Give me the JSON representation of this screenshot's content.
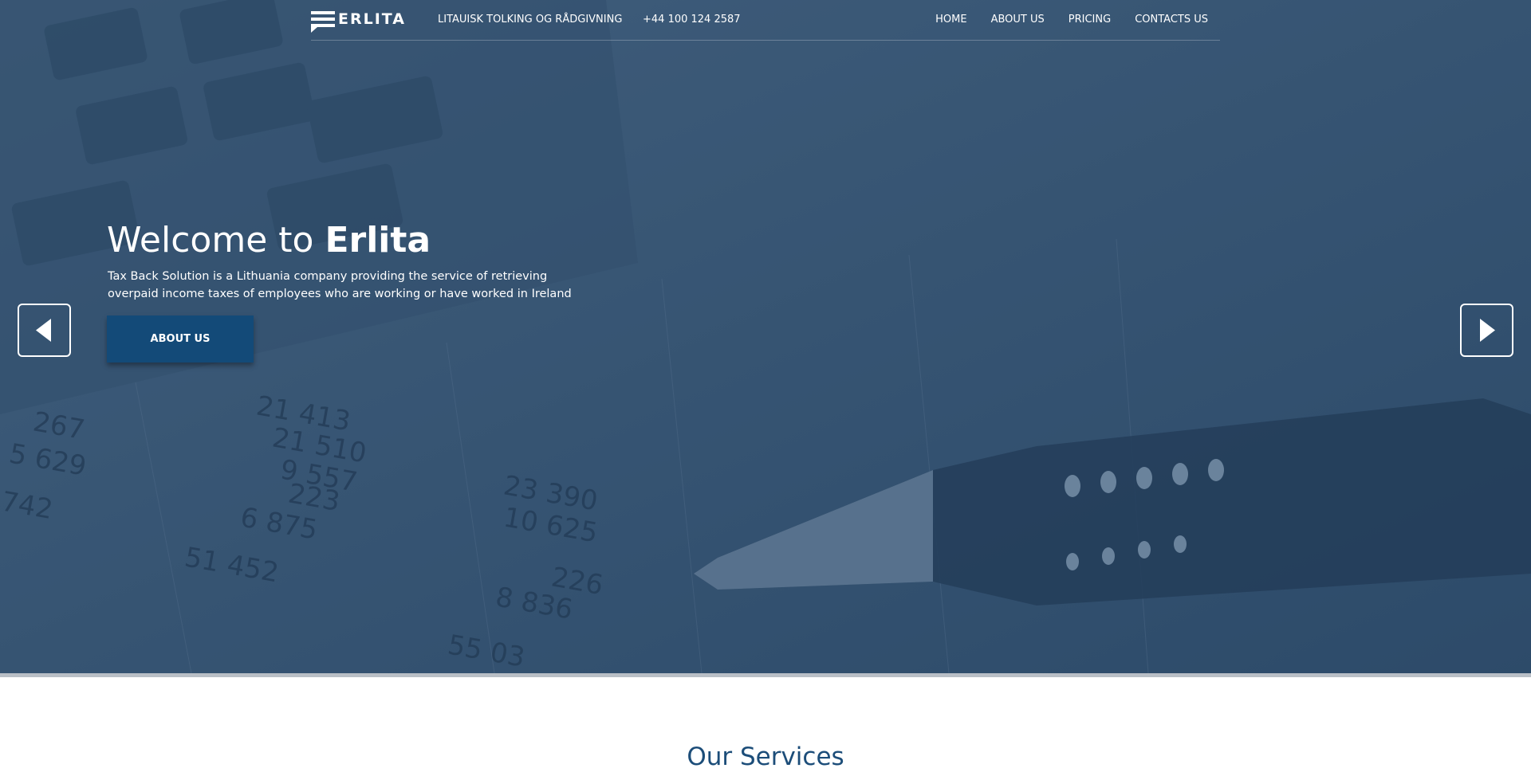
{
  "header": {
    "logo_text": "ERLITA",
    "tagline": "LITAUISK TOLKING OG RÅDGIVNING",
    "phone": "+44 100 124 2587",
    "nav": [
      {
        "label": "HOME"
      },
      {
        "label": "ABOUT US"
      },
      {
        "label": "PRICING"
      },
      {
        "label": "CONTACTS US"
      }
    ]
  },
  "slide": {
    "title_prefix": "Welcome to",
    "title_brand": "Erlita",
    "description": "Tax Back Solution is a Lithuania company providing the service of retrieving overpaid income taxes of employees who are working or have worked in Ireland",
    "button_label": "ABOUT US"
  },
  "services": {
    "title": "Our Services"
  },
  "colors": {
    "overlay": "#3a5673",
    "button": "#134a78",
    "heading": "#1c4d79"
  }
}
